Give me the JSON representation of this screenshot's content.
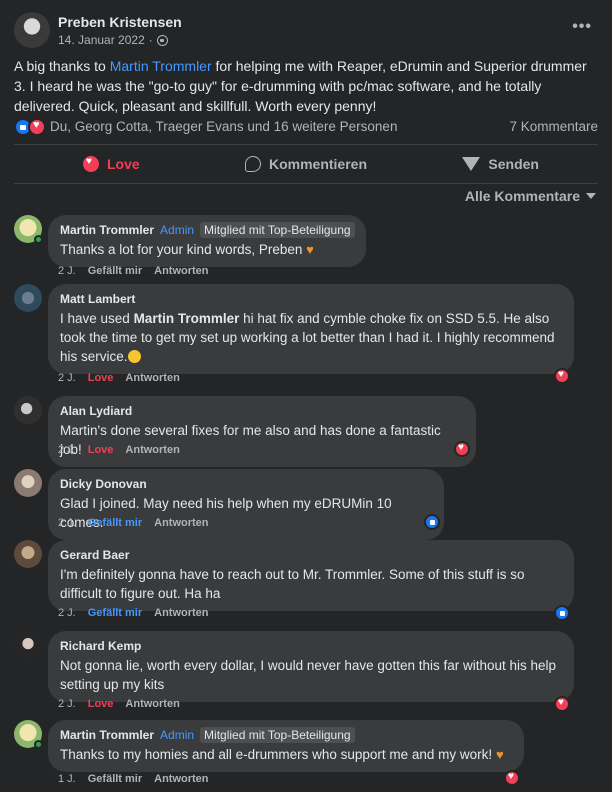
{
  "post": {
    "author": "Preben Kristensen",
    "date": "14. Januar 2022",
    "more_label": "•••",
    "text_before": "A big thanks to ",
    "mention": "Martin Trommler",
    "text_after": " for helping me with Reaper, eDrumin and Superior drummer 3. I heard he was the \"go-to guy\" for e-drumming with pc/mac software, and he totally delivered. Quick, pleasant and skillfull. Worth every penny!",
    "reactions_text": "Du, Georg Cotta, Traeger Evans und 16 weitere Personen",
    "comment_count": "7 Kommentare"
  },
  "actions": {
    "love": "Love",
    "comment": "Kommentieren",
    "send": "Senden"
  },
  "sort": {
    "label": "Alle Kommentare"
  },
  "comments": [
    {
      "author": "Martin Trommler",
      "admin_badge": "Admin",
      "top_badge": "Mitglied mit Top-Beteiligung",
      "text": "Thanks a lot for your kind words, Preben",
      "time": "2 J.",
      "reaction_action": "Gefällt mir",
      "reply": "Antworten"
    },
    {
      "author": "Matt Lambert",
      "text_before": "I have used ",
      "mention": "Martin Trommler",
      "text_after": " hi hat fix and cymble choke fix on SSD 5.5. He also took the time to get my set up working a lot better than I had it. I highly recommend his service.",
      "time": "2 J.",
      "reaction_action": "Love",
      "reply": "Antworten"
    },
    {
      "author": "Alan Lydiard",
      "text": "Martin's done several fixes for me also and has done a fantastic job!",
      "time": "2 J.",
      "reaction_action": "Love",
      "reply": "Antworten"
    },
    {
      "author": "Dicky Donovan",
      "text": "Glad I joined. May need his help when my eDRUMin 10 comes.",
      "time": "2 J.",
      "reaction_action": "Gefällt mir",
      "reply": "Antworten"
    },
    {
      "author": "Gerard Baer",
      "text": "I'm definitely gonna have to reach out to Mr. Trommler. Some of this stuff is so difficult to figure out. Ha ha",
      "time": "2 J.",
      "reaction_action": "Gefällt mir",
      "reply": "Antworten"
    },
    {
      "author": "Richard Kemp",
      "text": "Not gonna lie, worth every dollar, I would never have gotten this far without his help setting up my kits",
      "time": "2 J.",
      "reaction_action": "Love",
      "reply": "Antworten"
    },
    {
      "author": "Martin Trommler",
      "admin_badge": "Admin",
      "top_badge": "Mitglied mit Top-Beteiligung",
      "text": "Thanks to my homies and all e-drummers who support me and my work!",
      "time": "1 J.",
      "reaction_action": "Gefällt mir",
      "reply": "Antworten"
    }
  ]
}
